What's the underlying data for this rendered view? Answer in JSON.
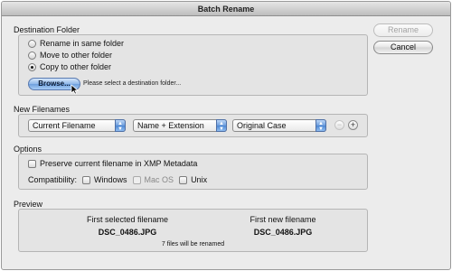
{
  "window": {
    "title": "Batch Rename"
  },
  "buttons": {
    "rename": "Rename",
    "cancel": "Cancel"
  },
  "destination": {
    "legend": "Destination Folder",
    "options": [
      {
        "label": "Rename in same folder",
        "selected": false
      },
      {
        "label": "Move to other folder",
        "selected": false
      },
      {
        "label": "Copy to other folder",
        "selected": true
      }
    ],
    "browse_label": "Browse...",
    "hint": "Please select a destination folder..."
  },
  "filenames": {
    "legend": "New Filenames",
    "selects": [
      "Current Filename",
      "Name + Extension",
      "Original Case"
    ],
    "remove_symbol": "−",
    "add_symbol": "+"
  },
  "options": {
    "legend": "Options",
    "preserve_label": "Preserve current filename in XMP Metadata",
    "preserve_checked": false,
    "compat_label": "Compatibility:",
    "compat": [
      {
        "label": "Windows",
        "checked": false,
        "enabled": true
      },
      {
        "label": "Mac OS",
        "checked": false,
        "enabled": false
      },
      {
        "label": "Unix",
        "checked": false,
        "enabled": true
      }
    ]
  },
  "preview": {
    "legend": "Preview",
    "first_selected_label": "First selected filename",
    "first_selected_value": "DSC_0486.JPG",
    "first_new_label": "First new filename",
    "first_new_value": "DSC_0486.JPG",
    "summary": "7 files will be renamed"
  }
}
